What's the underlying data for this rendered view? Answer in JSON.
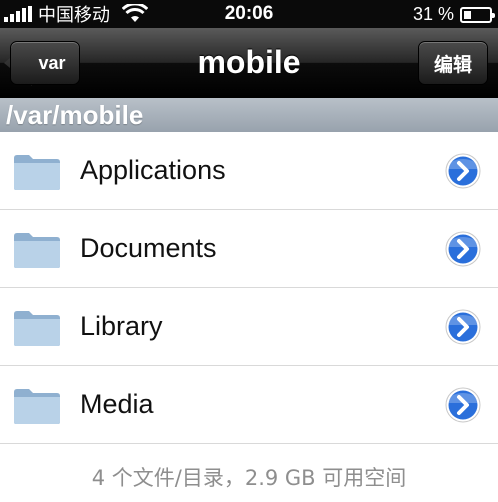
{
  "status_bar": {
    "carrier": "中国移动",
    "time": "20:06",
    "battery_text": "31 %",
    "battery_level": 0.31
  },
  "nav": {
    "back_label": "var",
    "title": "mobile",
    "edit_label": "编辑"
  },
  "path": "/var/mobile",
  "items": [
    {
      "label": "Applications"
    },
    {
      "label": "Documents"
    },
    {
      "label": "Library"
    },
    {
      "label": "Media"
    }
  ],
  "footer": "4 个文件/目录，2.9 GB 可用空间",
  "colors": {
    "disclosure": "#2a6fdb",
    "folder": "#a8c3dc"
  }
}
